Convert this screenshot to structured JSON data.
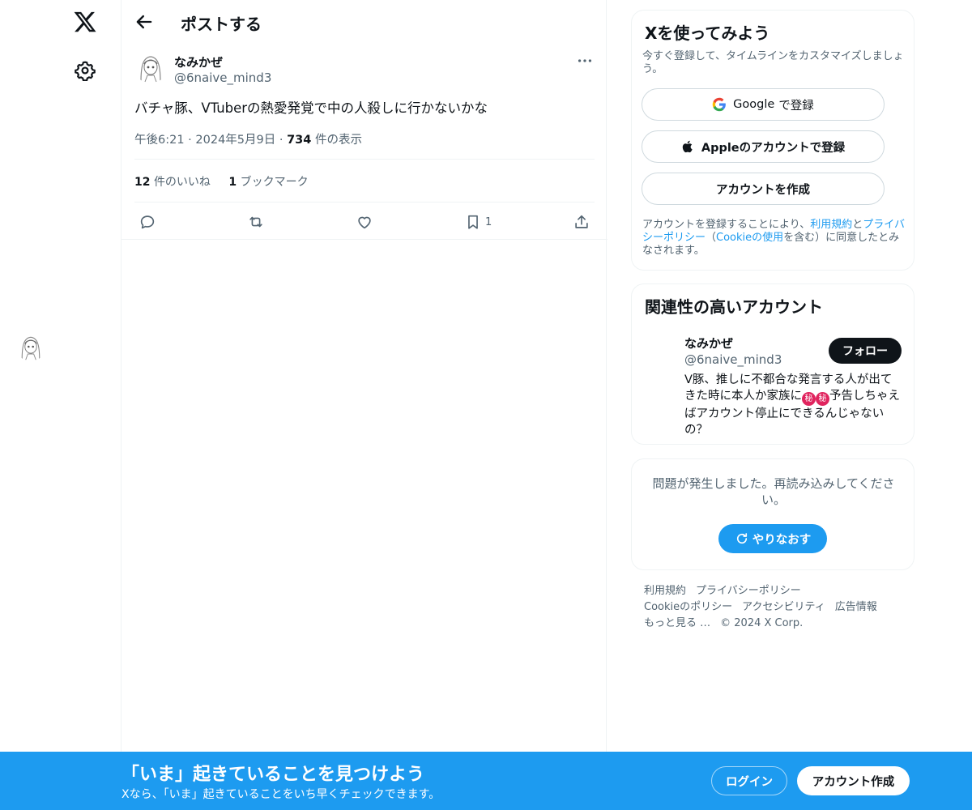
{
  "header": {
    "title": "ポストする"
  },
  "post": {
    "author_name": "なみかぜ",
    "author_handle": "@6naive_mind3",
    "text": "バチャ豚、VTuberの熱愛発覚で中の人殺しに行かないかな",
    "time": "午後6:21",
    "date": "2024年5月9日",
    "views_count": "734",
    "views_label": "件の表示",
    "likes_count": "12",
    "likes_label": "件のいいね",
    "bookmarks_count": "1",
    "bookmarks_label": "ブックマーク",
    "bookmark_action_count": "1"
  },
  "signup": {
    "title": "Xを使ってみよう",
    "subtitle": "今すぐ登録して、タイムラインをカスタマイズしましょう。",
    "google_brand": "Google",
    "google_label": "で登録",
    "apple_label": "Appleのアカウントで登録",
    "create_label": "アカウントを作成",
    "legal_prefix": "アカウントを登録することにより、",
    "legal_terms": "利用規約",
    "legal_and": "と",
    "legal_privacy": "プライバシーポリシー",
    "legal_open": "（",
    "legal_cookie": "Cookieの使用",
    "legal_suffix": "を含む）に同意したとみなされます。"
  },
  "related": {
    "title": "関連性の高いアカウント",
    "name": "なみかぜ",
    "handle": "@6naive_mind3",
    "follow_label": "フォロー",
    "bio_part1": "V豚、推しに不都合な発言する人が出てきた時に本人か家族に",
    "bio_emoji1": "秘",
    "bio_emoji2": "秘",
    "bio_part2": "予告しちゃえばアカウント停止にできるんじゃないの？"
  },
  "error": {
    "message": "問題が発生しました。再読み込みしてください。",
    "retry_label": "やりなおす"
  },
  "footer": {
    "links": [
      "利用規約",
      "プライバシーポリシー",
      "Cookieのポリシー",
      "アクセシビリティ",
      "広告情報",
      "もっと見る …"
    ],
    "copyright": "© 2024 X Corp."
  },
  "banner": {
    "title": "「いま」起きていることを見つけよう",
    "subtitle": "Xなら、「いま」起きていることをいち早くチェックできます。",
    "login_label": "ログイン",
    "create_label": "アカウント作成"
  },
  "colors": {
    "accent": "#1d9bf0",
    "text_primary": "#0f1419",
    "text_secondary": "#536471",
    "border": "#eff3f4"
  },
  "icons": [
    "x-logo-icon",
    "gear-icon",
    "back-arrow-icon",
    "more-dots-icon",
    "reply-icon",
    "repost-icon",
    "like-icon",
    "bookmark-icon",
    "share-icon",
    "google-icon",
    "apple-icon",
    "refresh-icon"
  ]
}
